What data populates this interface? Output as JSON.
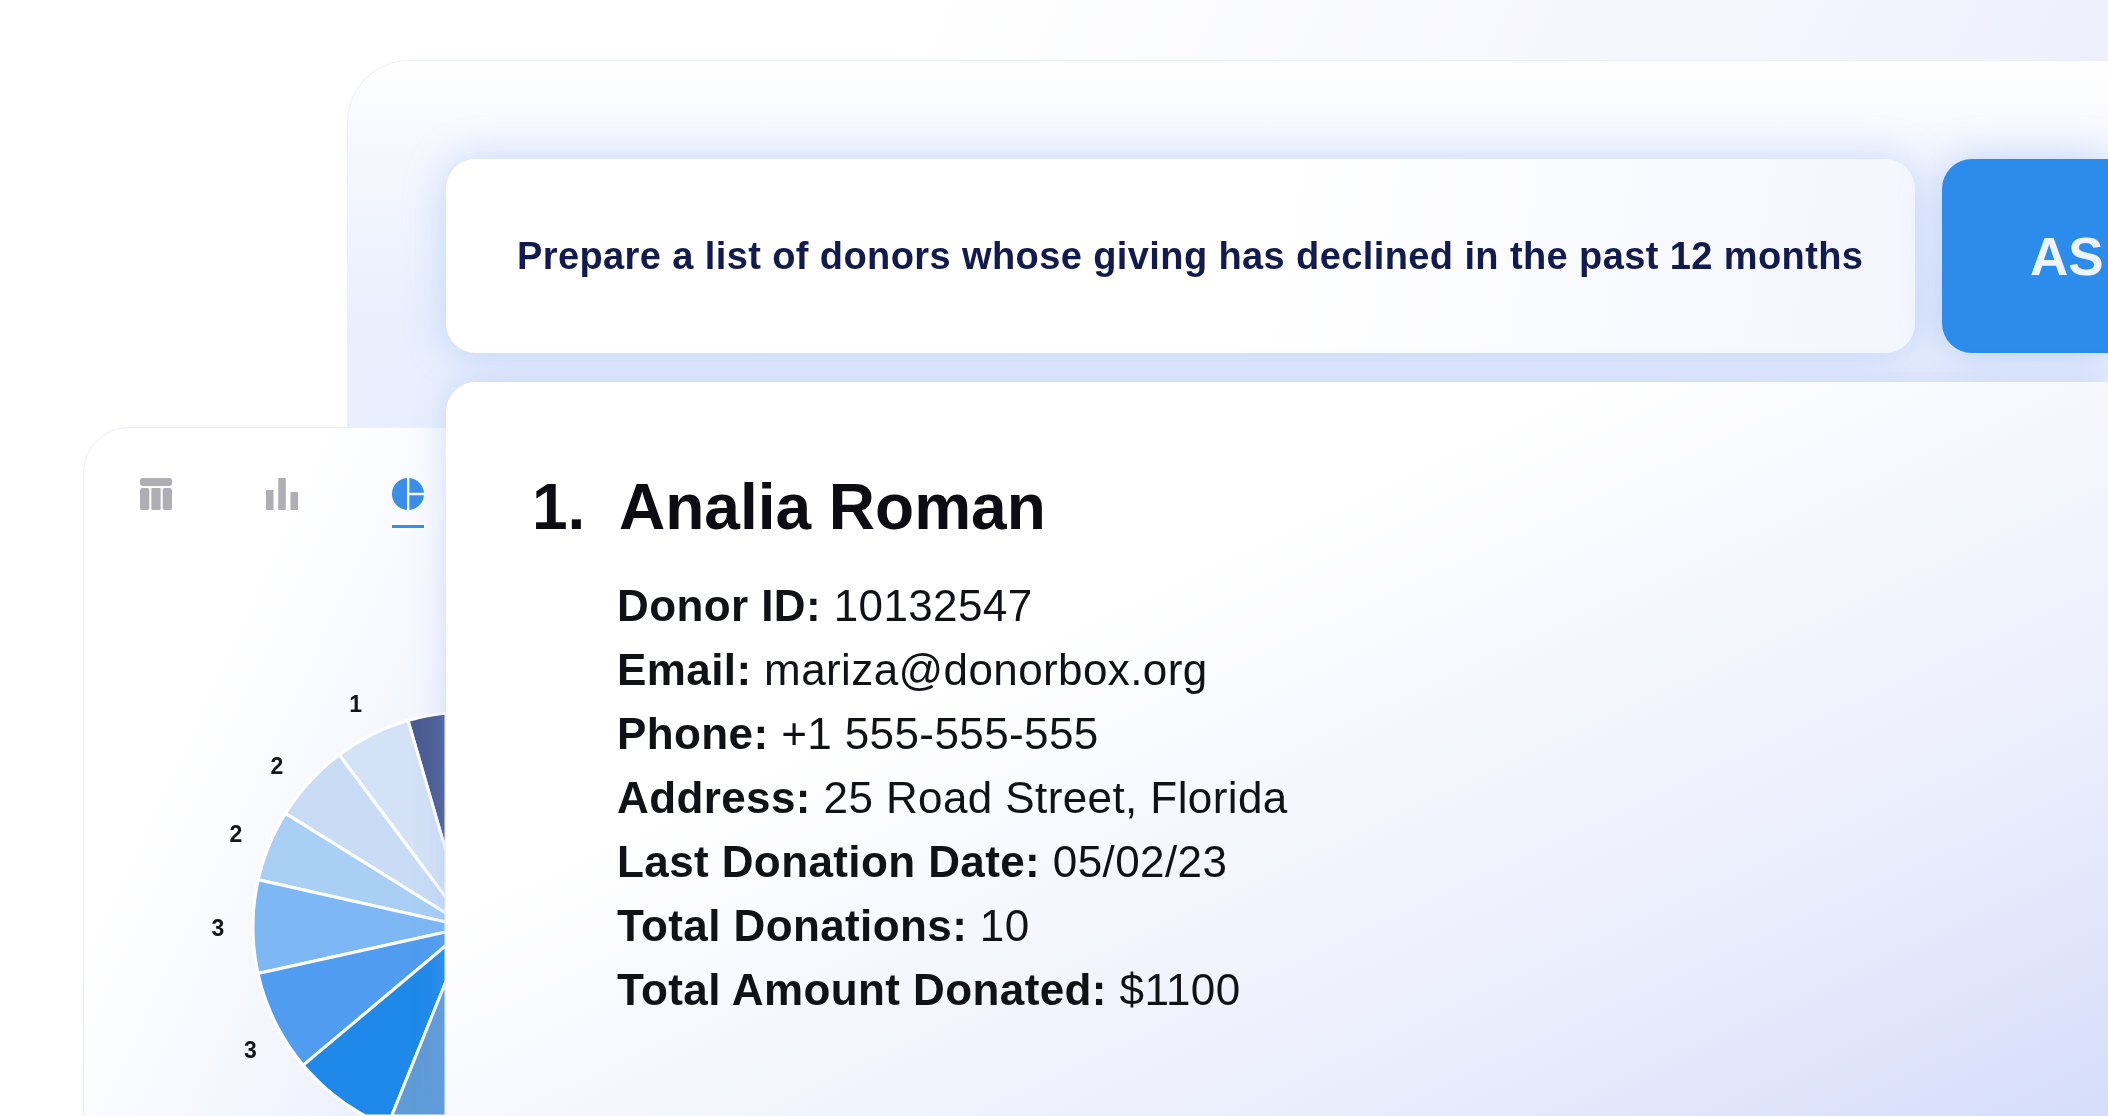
{
  "prompt_field": {
    "value": "Prepare a list of donors whose giving has declined in the past 12 months"
  },
  "ask_button": {
    "label": "AS"
  },
  "chart_panel": {
    "view_tabs": [
      {
        "kind": "table",
        "selected": false
      },
      {
        "kind": "bar",
        "selected": false
      },
      {
        "kind": "pie",
        "selected": true
      }
    ],
    "slice_labels": [
      "1",
      "2",
      "2",
      "3",
      "3"
    ]
  },
  "answer": {
    "donors": [
      {
        "number": "1.",
        "name": "Analia Roman",
        "details": [
          {
            "label": "Donor ID:",
            "value": "10132547"
          },
          {
            "label": "Email:",
            "value": "mariza@donorbox.org"
          },
          {
            "label": "Phone:",
            "value": "+1 555-555-555"
          },
          {
            "label": "Address:",
            "value": "25 Road Street, Florida"
          },
          {
            "label": "Last Donation Date:",
            "value": "05/02/23"
          },
          {
            "label": "Total Donations:",
            "value": "10"
          },
          {
            "label": "Total Amount Donated:",
            "value": "$1100"
          }
        ]
      }
    ]
  }
}
